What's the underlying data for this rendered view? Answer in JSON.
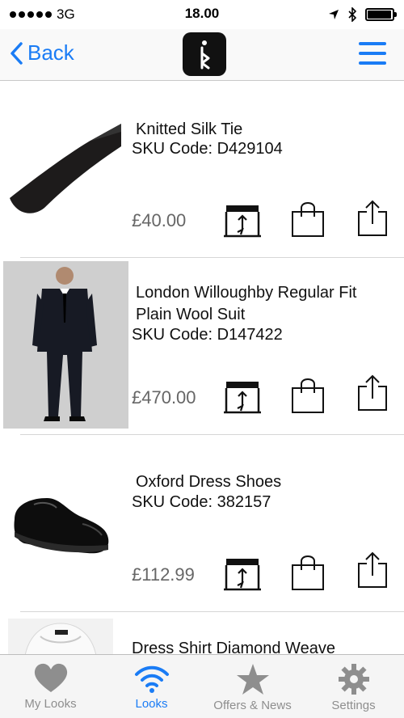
{
  "status_bar": {
    "carrier": "3G",
    "time": "18.00",
    "battery_level": 0.95
  },
  "nav": {
    "back_label": "Back",
    "logo_icon": "brand-logo-icon",
    "menu_icon": "hamburger-menu-icon"
  },
  "products": [
    {
      "title": "Knitted Silk Tie",
      "sku": "SKU Code: D429104",
      "price": "£40.00",
      "image": "tie-image"
    },
    {
      "title": "London Willoughby Regular Fit Plain Wool Suit",
      "sku": "SKU Code: D147422",
      "price": "£470.00",
      "image": "suit-image"
    },
    {
      "title": "Oxford Dress Shoes",
      "sku": "SKU Code: 382157",
      "price": "£112.99",
      "image": "shoes-image"
    },
    {
      "title": "Dress Shirt Diamond Weave",
      "image": "shirt-image"
    }
  ],
  "actions": {
    "store_icon": "store-locator-icon",
    "bag_icon": "shopping-bag-icon",
    "share_icon": "share-icon"
  },
  "tabs": [
    {
      "label": "My Looks",
      "icon": "heart-icon",
      "active": false
    },
    {
      "label": "Looks",
      "icon": "wifi-icon",
      "active": true
    },
    {
      "label": "Offers & News",
      "icon": "star-icon",
      "active": false
    },
    {
      "label": "Settings",
      "icon": "gear-icon",
      "active": false
    }
  ],
  "colors": {
    "accent": "#1a7cf5",
    "inactive_tab": "#8e8e8e",
    "price": "#666666"
  }
}
